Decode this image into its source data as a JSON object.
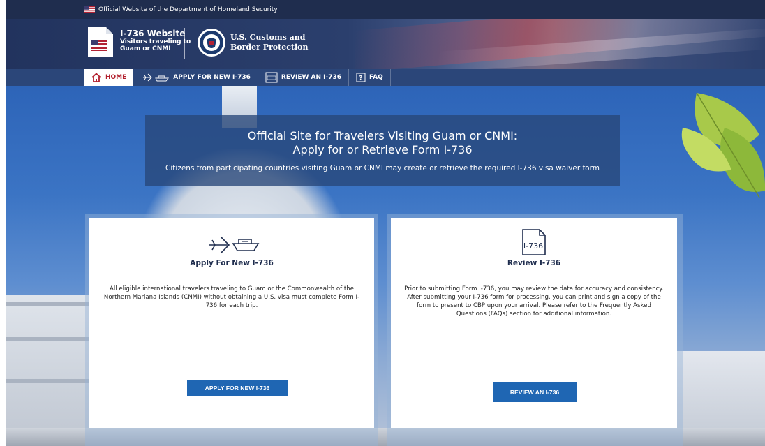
{
  "official_bar": {
    "text": "Official Website of the Department of Homeland Security"
  },
  "header": {
    "site_title": "I-736 Website",
    "site_subtitle_1": "Visitors traveling to",
    "site_subtitle_2": "Guam or CNMI",
    "agency_line_1": "U.S. Customs and",
    "agency_line_2": "Border Protection"
  },
  "nav": {
    "items": [
      {
        "label": "HOME",
        "icon": "home-icon",
        "active": true
      },
      {
        "label": "APPLY FOR NEW I-736",
        "icon": "plane-ship-icon",
        "active": false
      },
      {
        "label": "REVIEW AN I-736",
        "icon": "document-icon",
        "active": false
      },
      {
        "label": "FAQ",
        "icon": "question-icon",
        "active": false
      }
    ]
  },
  "hero": {
    "title_line_1": "Official Site for Travelers Visiting Guam or CNMI:",
    "title_line_2": "Apply for or Retrieve Form I-736",
    "subtitle": "Citizens from participating countries visiting Guam or CNMI may create or retrieve the required I-736 visa waiver form"
  },
  "cards": {
    "apply": {
      "icon": "plane-ship-icon",
      "title": "Apply For New I-736",
      "description": "All eligible international travelers traveling to Guam or the Commonwealth of the Northern Mariana Islands (CNMI) without obtaining a U.S. visa must complete Form I-736 for each trip.",
      "button": "APPLY FOR NEW I-736"
    },
    "review": {
      "icon": "document-icon",
      "icon_label": "I-736",
      "title": "Review I-736",
      "description": "Prior to submitting Form I-736, you may review the data for accuracy and consistency. After submitting your I-736 form for processing, you can print and sign a copy of the form to present to CBP upon your arrival. Please refer to the Frequently Asked Questions (FAQs) section for additional information.",
      "button": "REVIEW AN I-736"
    }
  },
  "colors": {
    "header_navy": "#22335e",
    "nav_blue": "#2b4679",
    "button_blue": "#1f66b3",
    "home_red": "#b21f2d"
  }
}
